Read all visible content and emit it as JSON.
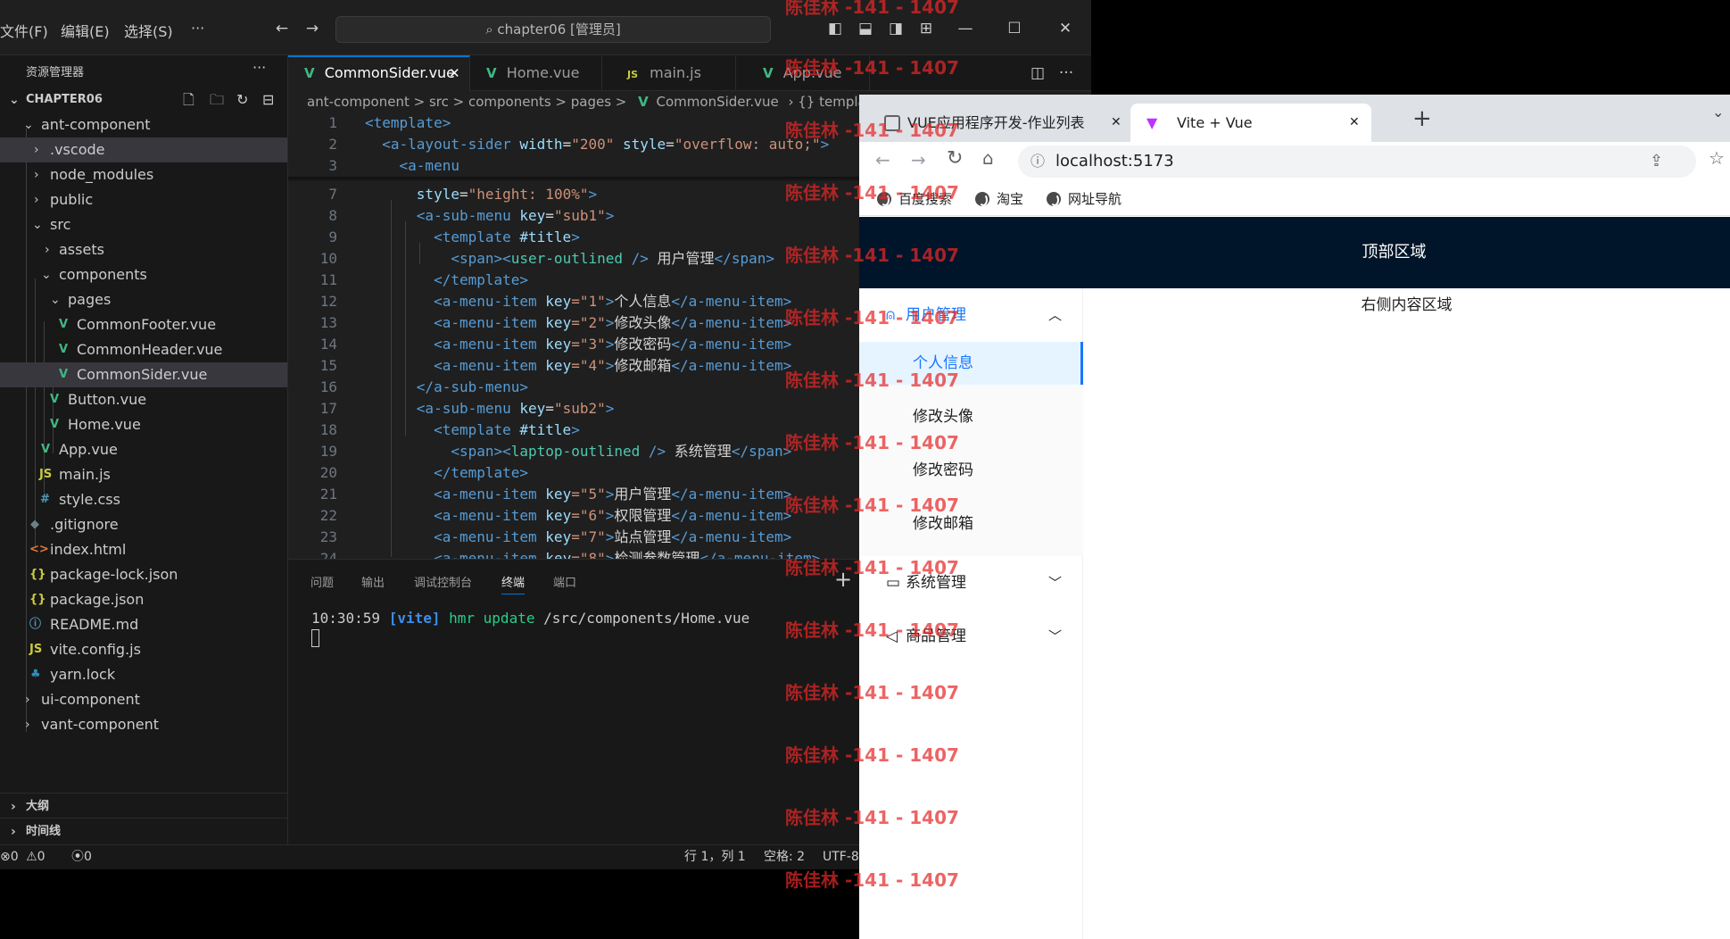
{
  "vscode": {
    "menus": [
      "文件(F)",
      "编辑(E)",
      "选择(S)",
      "···"
    ],
    "search": "chapter06 [管理员]",
    "explorer_title": "资源管理器",
    "root": "CHAPTER06",
    "tree": [
      {
        "label": "ant-component",
        "type": "folder-open"
      },
      {
        "label": ".vscode",
        "type": "folder"
      },
      {
        "label": "node_modules",
        "type": "folder"
      },
      {
        "label": "public",
        "type": "folder"
      },
      {
        "label": "src",
        "type": "folder-open"
      },
      {
        "label": "assets",
        "type": "folder"
      },
      {
        "label": "components",
        "type": "folder-open"
      },
      {
        "label": "pages",
        "type": "folder-open"
      },
      {
        "label": "CommonFooter.vue",
        "type": "vue"
      },
      {
        "label": "CommonHeader.vue",
        "type": "vue"
      },
      {
        "label": "CommonSider.vue",
        "type": "vue"
      },
      {
        "label": "Button.vue",
        "type": "vue"
      },
      {
        "label": "Home.vue",
        "type": "vue"
      },
      {
        "label": "App.vue",
        "type": "vue"
      },
      {
        "label": "main.js",
        "type": "js"
      },
      {
        "label": "style.css",
        "type": "css"
      },
      {
        "label": ".gitignore",
        "type": "git"
      },
      {
        "label": "index.html",
        "type": "html"
      },
      {
        "label": "package-lock.json",
        "type": "json"
      },
      {
        "label": "package.json",
        "type": "json"
      },
      {
        "label": "README.md",
        "type": "info"
      },
      {
        "label": "vite.config.js",
        "type": "js"
      },
      {
        "label": "yarn.lock",
        "type": "yarn"
      },
      {
        "label": "ui-component",
        "type": "folder"
      },
      {
        "label": "vant-component",
        "type": "folder"
      }
    ],
    "outline": "大纲",
    "timeline": "时间线",
    "tabs": [
      "CommonSider.vue",
      "Home.vue",
      "main.js",
      "App.vue"
    ],
    "breadcrumb": "ant-component  >  src  >  components  >  pages  >",
    "breadcrumb_file": "CommonSider.vue",
    "breadcrumb_sym": "{} template",
    "line_numbers": [
      "1",
      "2",
      "3",
      "7",
      "8",
      "9",
      "10",
      "11",
      "12",
      "13",
      "14",
      "15",
      "16",
      "17",
      "18",
      "19",
      "20",
      "21",
      "22",
      "23",
      "24"
    ],
    "code": {
      "l1": "<template>",
      "l2a": "  <a-layout-sider ",
      "l2b": "width",
      "l2c": "=",
      "l2d": "\"200\"",
      "l2e": " style",
      "l2f": "=",
      "l2g": "\"overflow: auto;\"",
      "l2h": ">",
      "l3": "    <a-menu",
      "l7a": "      style",
      "l7b": "=",
      "l7c": "\"height: 100%\"",
      "l7d": ">",
      "l8a": "      <a-sub-menu ",
      "l8b": "key",
      "l8c": "=",
      "l8d": "\"sub1\"",
      "l8e": ">",
      "l9a": "        <template ",
      "l9b": "#title",
      "l9c": ">",
      "l10a": "          <span><",
      "l10b": "user-outlined",
      "l10c": " /> ",
      "l10d": "用户管理",
      "l10e": "</span>",
      "l11": "        </template>",
      "l12a": "        <a-menu-item ",
      "l12b": "key",
      "l12c": "=\"1\"",
      "l12d": ">",
      "l12e": "个人信息",
      "l12f": "</a-menu-item>",
      "l13e": "修改头像",
      "l13c": "=\"2\"",
      "l14e": "修改密码",
      "l14c": "=\"3\"",
      "l15e": "修改邮箱",
      "l15c": "=\"4\"",
      "l16": "      </a-sub-menu>",
      "l17d": "\"sub2\"",
      "l19b": "laptop-outlined",
      "l19d": "系统管理",
      "l21e": "用户管理",
      "l21c": "=\"5\"",
      "l22e": "权限管理",
      "l22c": "=\"6\"",
      "l23e": "站点管理",
      "l23c": "=\"7\"",
      "l24e": "检测参数管理",
      "l24c": "=\"8\""
    },
    "panel_tabs": [
      "问题",
      "输出",
      "调试控制台",
      "终端",
      "端口"
    ],
    "terminal": {
      "time": "10:30:59 ",
      "tag": "[vite]",
      "msg": " hmr update ",
      "path": "/src/components/Home.vue"
    },
    "status": {
      "errors": "0",
      "warnings": "0",
      "ports": "0",
      "cursor": "行 1，列 1",
      "spaces": "空格: 2",
      "encoding": "UTF-8"
    }
  },
  "chrome": {
    "tabs": [
      "VUE应用程序开发-作业列表",
      "Vite + Vue"
    ],
    "url": "localhost:5173",
    "bookmarks": [
      "百度搜索",
      "淘宝",
      "网址导航"
    ],
    "app": {
      "header": "顶部区域",
      "content": "右侧内容区域",
      "menus": [
        {
          "title": "用户管理",
          "items": [
            "个人信息",
            "修改头像",
            "修改密码",
            "修改邮箱"
          ]
        },
        {
          "title": "系统管理"
        },
        {
          "title": "商品管理"
        }
      ]
    }
  },
  "watermark": "陈佳林 -141 - 1407"
}
